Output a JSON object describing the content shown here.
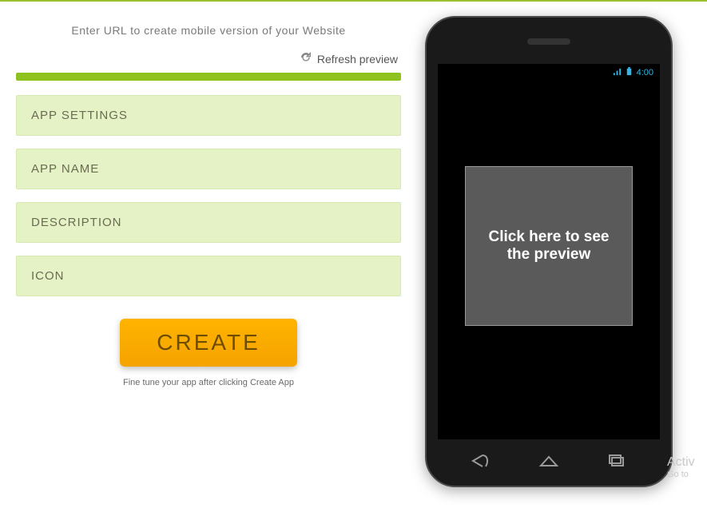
{
  "prompt": "Enter URL to create mobile version of your Website",
  "refresh_label": "Refresh preview",
  "accordion": [
    {
      "label": "APP SETTINGS"
    },
    {
      "label": "APP NAME"
    },
    {
      "label": "DESCRIPTION"
    },
    {
      "label": "ICON"
    }
  ],
  "create_button": "CREATE",
  "fine_tune": "Fine tune your app after clicking Create App",
  "phone": {
    "time": "4:00",
    "preview_text": "Click here to see the preview"
  },
  "watermark": {
    "line1": "Activ",
    "line2": "Go to"
  }
}
